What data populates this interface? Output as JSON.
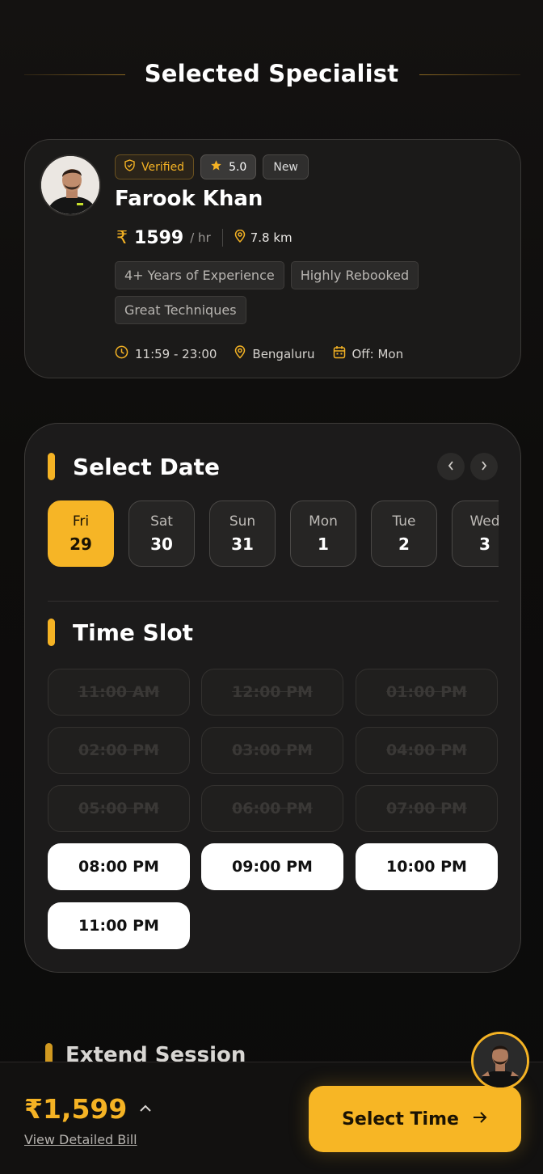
{
  "header": {
    "title": "Selected Specialist"
  },
  "specialist": {
    "name": "Farook Khan",
    "badges": {
      "verified": "Verified",
      "rating": "5.0",
      "new": "New"
    },
    "currency_symbol": "₹",
    "price": "1599",
    "price_unit": "/ hr",
    "distance": "7.8 km",
    "tags": [
      "4+ Years of Experience",
      "Highly Rebooked",
      "Great Techniques"
    ],
    "hours": "11:59 - 23:00",
    "city": "Bengaluru",
    "off_day": "Off: Mon"
  },
  "date_section": {
    "title": "Select Date",
    "dates": [
      {
        "day": "Fri",
        "num": "29",
        "selected": true
      },
      {
        "day": "Sat",
        "num": "30",
        "selected": false
      },
      {
        "day": "Sun",
        "num": "31",
        "selected": false
      },
      {
        "day": "Mon",
        "num": "1",
        "selected": false
      },
      {
        "day": "Tue",
        "num": "2",
        "selected": false
      },
      {
        "day": "Wed",
        "num": "3",
        "selected": false
      }
    ]
  },
  "time_section": {
    "title": "Time Slot",
    "slots": [
      {
        "label": "11:00 AM",
        "available": false
      },
      {
        "label": "12:00 PM",
        "available": false
      },
      {
        "label": "01:00 PM",
        "available": false
      },
      {
        "label": "02:00 PM",
        "available": false
      },
      {
        "label": "03:00 PM",
        "available": false
      },
      {
        "label": "04:00 PM",
        "available": false
      },
      {
        "label": "05:00 PM",
        "available": false
      },
      {
        "label": "06:00 PM",
        "available": false
      },
      {
        "label": "07:00 PM",
        "available": false
      },
      {
        "label": "08:00 PM",
        "available": true
      },
      {
        "label": "09:00 PM",
        "available": true
      },
      {
        "label": "10:00 PM",
        "available": true
      },
      {
        "label": "11:00 PM",
        "available": true
      }
    ]
  },
  "extend_section": {
    "title": "Extend Session"
  },
  "footer": {
    "total": "₹1,599",
    "bill_link": "View Detailed Bill",
    "cta_label": "Select Time"
  },
  "colors": {
    "accent": "#f5b324",
    "background": "#0d0c0b",
    "card": "#1b1a19"
  },
  "icons": [
    "shield-check-icon",
    "star-icon",
    "rupee-icon",
    "map-pin-icon",
    "clock-icon",
    "calendar-icon",
    "chevron-left-icon",
    "chevron-right-icon",
    "chevron-up-icon",
    "arrow-right-icon"
  ]
}
